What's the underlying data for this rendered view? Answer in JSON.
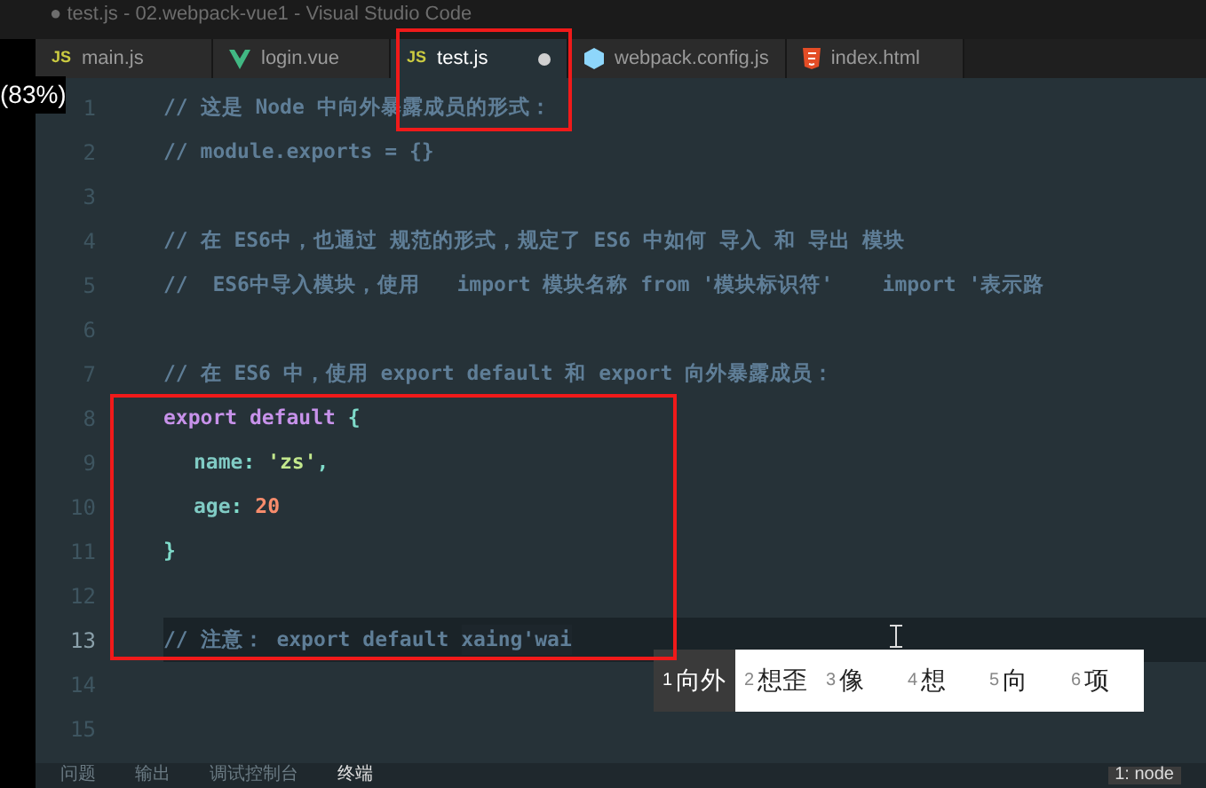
{
  "window": {
    "title": "● test.js - 02.webpack-vue1 - Visual Studio Code"
  },
  "zoom_label": "(83%)",
  "tabs": [
    {
      "label": "main.js",
      "kind": "js",
      "icon_text": "JS",
      "selected": false,
      "dirty": false
    },
    {
      "label": "login.vue",
      "kind": "vue",
      "selected": false,
      "dirty": false
    },
    {
      "label": "test.js",
      "kind": "js",
      "icon_text": "JS",
      "selected": true,
      "dirty": true
    },
    {
      "label": "webpack.config.js",
      "kind": "config",
      "selected": false,
      "dirty": false
    },
    {
      "label": "index.html",
      "kind": "html",
      "selected": false,
      "dirty": false
    }
  ],
  "editor": {
    "lines": [
      {
        "number": "1",
        "current": false,
        "tokens": [
          {
            "kind": "comment",
            "text": "// 这是 Node 中向外暴露成员的形式："
          }
        ]
      },
      {
        "number": "2",
        "current": false,
        "tokens": [
          {
            "kind": "comment",
            "text": "// module.exports = {}"
          }
        ]
      },
      {
        "number": "3",
        "current": false
      },
      {
        "number": "4",
        "current": false,
        "tokens": [
          {
            "kind": "comment",
            "text": "// 在 ES6中，也通过 规范的形式，规定了 ES6 中如何 导入 和 导出 模块"
          }
        ]
      },
      {
        "number": "5",
        "current": false,
        "tokens": [
          {
            "kind": "comment",
            "text": "//  ES6中导入模块，使用   import 模块名称 from '模块标识符'    import '表示路"
          }
        ]
      },
      {
        "number": "6",
        "current": false
      },
      {
        "number": "7",
        "current": false,
        "tokens": [
          {
            "kind": "comment",
            "text": "// 在 ES6 中，使用 export default 和 export 向外暴露成员："
          }
        ]
      },
      {
        "number": "8",
        "current": false,
        "tokens": [
          {
            "kind": "keyword",
            "text": "export default "
          },
          {
            "kind": "punct",
            "text": "{"
          }
        ]
      },
      {
        "number": "9",
        "current": false,
        "indented": true,
        "tokens": [
          {
            "kind": "prop",
            "text": "name"
          },
          {
            "kind": "punct",
            "text": ": "
          },
          {
            "kind": "string",
            "text": "'zs'"
          },
          {
            "kind": "punct",
            "text": ","
          }
        ]
      },
      {
        "number": "10",
        "current": false,
        "indented": true,
        "tokens": [
          {
            "kind": "prop",
            "text": "age"
          },
          {
            "kind": "punct",
            "text": ": "
          },
          {
            "kind": "number",
            "text": "20"
          }
        ]
      },
      {
        "number": "11",
        "current": false,
        "tokens": [
          {
            "kind": "punct",
            "text": "}"
          }
        ]
      },
      {
        "number": "12",
        "current": false
      },
      {
        "number": "13",
        "current": true,
        "tokens": [
          {
            "kind": "comment",
            "text": "// 注意： export default "
          },
          {
            "kind": "composing",
            "text": "xaing'wai"
          }
        ]
      },
      {
        "number": "14",
        "current": false
      },
      {
        "number": "15",
        "current": false
      }
    ]
  },
  "ime_candidates": [
    {
      "index": "1",
      "text": "向外",
      "selected": true
    },
    {
      "index": "2",
      "text": "想歪",
      "selected": false
    },
    {
      "index": "3",
      "text": "像",
      "selected": false
    },
    {
      "index": "4",
      "text": "想",
      "selected": false
    },
    {
      "index": "5",
      "text": "向",
      "selected": false
    },
    {
      "index": "6",
      "text": "项",
      "selected": false
    }
  ],
  "panel_tabs": [
    {
      "label": "问题",
      "selected": false
    },
    {
      "label": "输出",
      "selected": false
    },
    {
      "label": "调试控制台",
      "selected": false
    },
    {
      "label": "终端",
      "selected": true
    }
  ],
  "terminal_select": "1: node"
}
